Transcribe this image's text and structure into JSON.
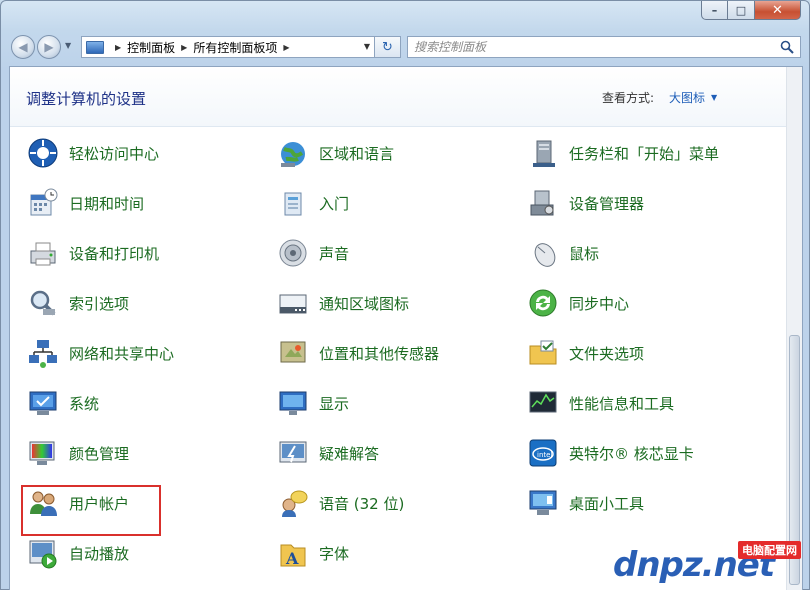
{
  "window": {
    "buttons": {
      "minimize": "–",
      "maximize": "□",
      "close": "✕"
    }
  },
  "nav": {
    "breadcrumbs": [
      "控制面板",
      "所有控制面板项"
    ],
    "search_placeholder": "搜索控制面板"
  },
  "header": {
    "title": "调整计算机的设置",
    "view_label": "查看方式:",
    "view_value": "大图标"
  },
  "items": [
    {
      "label": "轻松访问中心",
      "icon": "ease-of-access-icon"
    },
    {
      "label": "区域和语言",
      "icon": "region-language-icon"
    },
    {
      "label": "任务栏和「开始」菜单",
      "icon": "taskbar-icon"
    },
    {
      "label": "日期和时间",
      "icon": "date-time-icon"
    },
    {
      "label": "入门",
      "icon": "getting-started-icon"
    },
    {
      "label": "设备管理器",
      "icon": "device-manager-icon"
    },
    {
      "label": "设备和打印机",
      "icon": "printer-icon"
    },
    {
      "label": "声音",
      "icon": "sound-icon"
    },
    {
      "label": "鼠标",
      "icon": "mouse-icon"
    },
    {
      "label": "索引选项",
      "icon": "indexing-icon"
    },
    {
      "label": "通知区域图标",
      "icon": "notification-area-icon"
    },
    {
      "label": "同步中心",
      "icon": "sync-center-icon"
    },
    {
      "label": "网络和共享中心",
      "icon": "network-icon"
    },
    {
      "label": "位置和其他传感器",
      "icon": "location-sensor-icon"
    },
    {
      "label": "文件夹选项",
      "icon": "folder-options-icon"
    },
    {
      "label": "系统",
      "icon": "system-icon"
    },
    {
      "label": "显示",
      "icon": "display-icon"
    },
    {
      "label": "性能信息和工具",
      "icon": "performance-icon"
    },
    {
      "label": "颜色管理",
      "icon": "color-management-icon"
    },
    {
      "label": "疑难解答",
      "icon": "troubleshooting-icon"
    },
    {
      "label": "英特尔® 核芯显卡",
      "icon": "intel-graphics-icon"
    },
    {
      "label": "用户帐户",
      "icon": "user-accounts-icon"
    },
    {
      "label": "语音 (32 位)",
      "icon": "speech-icon"
    },
    {
      "label": "桌面小工具",
      "icon": "gadgets-icon"
    },
    {
      "label": "自动播放",
      "icon": "autoplay-icon"
    },
    {
      "label": "字体",
      "icon": "fonts-icon"
    }
  ],
  "watermark": {
    "text": "dnpz.net",
    "badge": "电脑配置网"
  },
  "colors": {
    "link_green": "#1b6b21",
    "title_blue": "#1e3287",
    "highlight_red": "#d9302c"
  }
}
